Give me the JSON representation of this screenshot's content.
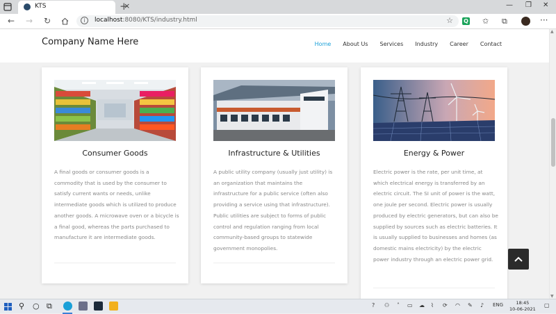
{
  "browser": {
    "tab_title": "KTS",
    "tab_close": "×",
    "new_tab": "+",
    "url_host": "localhost",
    "url_path": ":8080/KTS/industry.html",
    "extension_badge": "Q"
  },
  "site": {
    "brand": "Company Name Here",
    "nav": [
      "Home",
      "About Us",
      "Services",
      "Industry",
      "Career",
      "Contact"
    ],
    "active_nav": "Home",
    "accent_color": "#1aa0d8"
  },
  "cards": [
    {
      "title": "Consumer Goods",
      "text": "A final goods or consumer goods is a commodity that is used by the consumer to satisfy current wants or needs, unlike intermediate goods which is utilized to produce another goods. A microwave oven or a bicycle is a final good, whereas the parts purchased to manufacture it are intermediate goods."
    },
    {
      "title": "Infrastructure & Utilities",
      "text": "A public utility company (usually just utility) is an organization that maintains the infrastructure for a public service (often also providing a service using that infrastructure). Public utilities are subject to forms of public control and regulation ranging from local community-based groups to statewide government monopolies."
    },
    {
      "title": "Energy & Power",
      "text": "Electric power is the rate, per unit time, at which electrical energy is transferred by an electric circuit. The SI unit of power is the watt, one joule per second. Electric power is usually produced by electric generators, but can also be supplied by sources such as electric batteries. It is usually supplied to businesses and homes (as domestic mains electricity) by the electric power industry through an electric power grid."
    }
  ],
  "back_to_top": "^",
  "taskbar": {
    "language": "ENG",
    "time": "18:45",
    "date": "10-06-2021"
  }
}
